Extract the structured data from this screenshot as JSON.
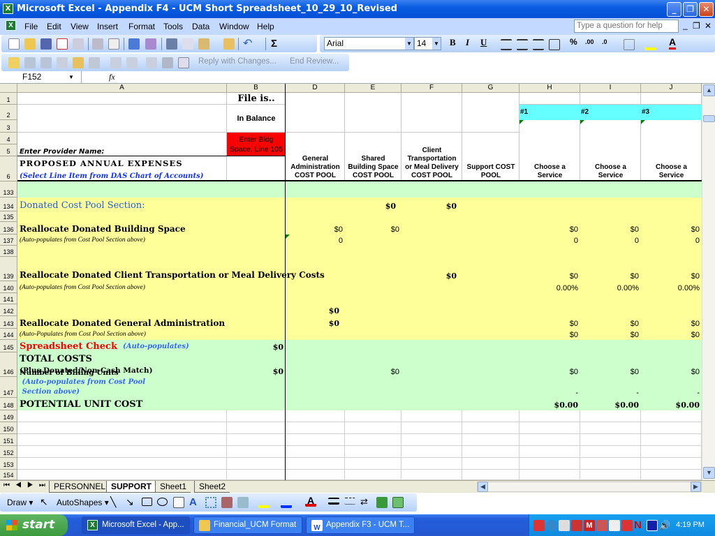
{
  "window": {
    "title": "Microsoft Excel - Appendix F4 - UCM Short Spreadsheet_10_29_10_Revised",
    "minimize": "_",
    "restore": "❐",
    "close": "✕"
  },
  "menubar": {
    "items": [
      "File",
      "Edit",
      "View",
      "Insert",
      "Format",
      "Tools",
      "Data",
      "Window",
      "Help"
    ],
    "help_placeholder": "Type a question for help",
    "doc_min": "_",
    "doc_restore": "❐",
    "doc_close": "✕"
  },
  "toolbar": {
    "font": "Arial",
    "size": "14",
    "bold": "B",
    "italic": "I",
    "underline": "U",
    "percent": "%",
    "sigma": "Σ",
    "inc_dec": ".00",
    "dec_dec": ".0",
    "font_color": "A"
  },
  "reviewing": {
    "reply": "Reply with Changes...",
    "end_review": "End Review..."
  },
  "formula_bar": {
    "name_box": "F152",
    "fx": "fx",
    "value": ""
  },
  "columns": [
    "A",
    "B",
    "D",
    "E",
    "F",
    "G",
    "H",
    "I",
    "J"
  ],
  "header": {
    "b1": "File is..",
    "b2": "In Balance",
    "b4": "Enter Bldg Space, Line 105",
    "a5": "Enter Provider Name:",
    "a6_title": "PROPOSED ANNUAL EXPENSES",
    "a6_note": "(Select Line Item from DAS Chart of Accounts)",
    "d6": "General Administration COST POOL",
    "e6": "Shared Building Space COST POOL",
    "f6": "Client Transportation or Meal Delivery COST POOL",
    "g6": "Support COST POOL",
    "h2": "#1",
    "i2": "#2",
    "j2": "#3",
    "h6": "Choose a Service",
    "i6": "Choose a Service",
    "j6": "Choose a Service",
    "row_numbers": [
      "1",
      "2",
      "3",
      "4",
      "5",
      "6"
    ]
  },
  "colors": {
    "yellow": "#ffff99",
    "green": "#ccffcc",
    "cyan": "#66ffff",
    "red": "#ff0000",
    "blue_note": "#3366ff",
    "section_blue": "#1f5fd6"
  },
  "rows": [
    {
      "num": "133",
      "bg": "green",
      "a": [],
      "cells": {}
    },
    {
      "num": "134",
      "bg": "yellow",
      "a": [
        {
          "t": "Donated Cost Pool Section:",
          "s": "section"
        }
      ],
      "cells": {
        "E": "$0",
        "F": "$0"
      }
    },
    {
      "num": "135",
      "bg": "yellow",
      "a": [],
      "cells": {}
    },
    {
      "num": "136",
      "bg": "yellow",
      "a": [
        {
          "t": "Reallocate Donated Building Space",
          "s": "label"
        }
      ],
      "cells": {
        "D": "$0",
        "E": "$0",
        "H": "$0",
        "I": "$0",
        "J": "$0"
      }
    },
    {
      "num": "137",
      "bg": "yellow",
      "a": [
        {
          "t": "(Auto-populates from Cost Pool Section above)",
          "s": "note"
        }
      ],
      "cells": {
        "D": "0",
        "H": "0",
        "I": "0",
        "J": "0"
      }
    },
    {
      "num": "138",
      "bg": "yellow",
      "a": [],
      "cells": {}
    },
    {
      "num": "139",
      "bg": "yellow",
      "a": [
        {
          "t": "Reallocate Donated Client Transportation or Meal Delivery Costs",
          "s": "label"
        }
      ],
      "cells": {
        "F": "$0",
        "H": "$0",
        "I": "$0",
        "J": "$0"
      }
    },
    {
      "num": "140",
      "bg": "yellow",
      "a": [
        {
          "t": "(Auto-populates from Cost Pool Section above)",
          "s": "note"
        }
      ],
      "cells": {
        "H": "0.00%",
        "I": "0.00%",
        "J": "0.00%"
      }
    },
    {
      "num": "141",
      "bg": "yellow",
      "a": [],
      "cells": {}
    },
    {
      "num": "142",
      "bg": "yellow",
      "a": [],
      "cells": {
        "D": "$0"
      }
    },
    {
      "num": "143",
      "bg": "yellow",
      "a": [
        {
          "t": "Reallocate Donated General Administration",
          "s": "label"
        }
      ],
      "cells": {
        "D": "$0",
        "H": "$0",
        "I": "$0",
        "J": "$0"
      }
    },
    {
      "num": "144",
      "bg": "yellow",
      "a": [
        {
          "t": "(Auto-Populates from Cost Pool Section above)",
          "s": "note"
        }
      ],
      "cells": {
        "H": "$0",
        "I": "$0",
        "J": "$0"
      }
    },
    {
      "num": "145",
      "bg": "green",
      "a": [
        {
          "t": "Spreadsheet Check ",
          "s": "red"
        },
        {
          "t": " (Auto-populates)",
          "s": "blue"
        }
      ],
      "cells": {
        "B": "$0"
      }
    },
    {
      "num": "146",
      "bg": "green",
      "a": [
        {
          "t": "TOTAL COSTS",
          "s": "title"
        },
        {
          "t": "(Plus Donated/Non-Cash Match)",
          "s": "labelsm",
          "br": true
        }
      ],
      "cells": {
        "B": "$0",
        "E": "$0",
        "H": "$0",
        "I": "$0",
        "J": "$0"
      }
    },
    {
      "num": "147",
      "bg": "green",
      "a": [
        {
          "t": "Number of Billing Units ",
          "s": "labelsm"
        },
        {
          "t": " (Auto-populates from Cost Pool",
          "s": "blue"
        },
        {
          "t": " Section above)",
          "s": "blue",
          "br": true
        }
      ],
      "cells": {
        "H": "-",
        "I": "-",
        "J": "-"
      }
    },
    {
      "num": "148",
      "bg": "green",
      "a": [
        {
          "t": "POTENTIAL UNIT COST",
          "s": "title"
        }
      ],
      "cells": {
        "H": "$0.00",
        "I": "$0.00",
        "J": "$0.00"
      }
    },
    {
      "num": "149",
      "bg": "white",
      "a": [],
      "cells": {}
    },
    {
      "num": "150",
      "bg": "white",
      "a": [],
      "cells": {}
    },
    {
      "num": "151",
      "bg": "white",
      "a": [],
      "cells": {}
    },
    {
      "num": "152",
      "bg": "white",
      "a": [],
      "cells": {}
    },
    {
      "num": "153",
      "bg": "white",
      "a": [],
      "cells": {}
    },
    {
      "num": "154",
      "bg": "white",
      "a": [],
      "cells": {}
    }
  ],
  "sheet_tabs": [
    {
      "label": "PERSONNEL",
      "active": false
    },
    {
      "label": "SUPPORT",
      "active": true
    },
    {
      "label": "Sheet1",
      "active": false
    },
    {
      "label": "Sheet2",
      "active": false
    }
  ],
  "drawing": {
    "draw": "Draw ▾",
    "autoshapes": "AutoShapes ▾"
  },
  "taskbar": {
    "start": "start",
    "tasks": [
      "Microsoft Excel - App...",
      "Financial_UCM Format",
      "Appendix F3 - UCM T..."
    ],
    "clock": "4:19 PM"
  }
}
